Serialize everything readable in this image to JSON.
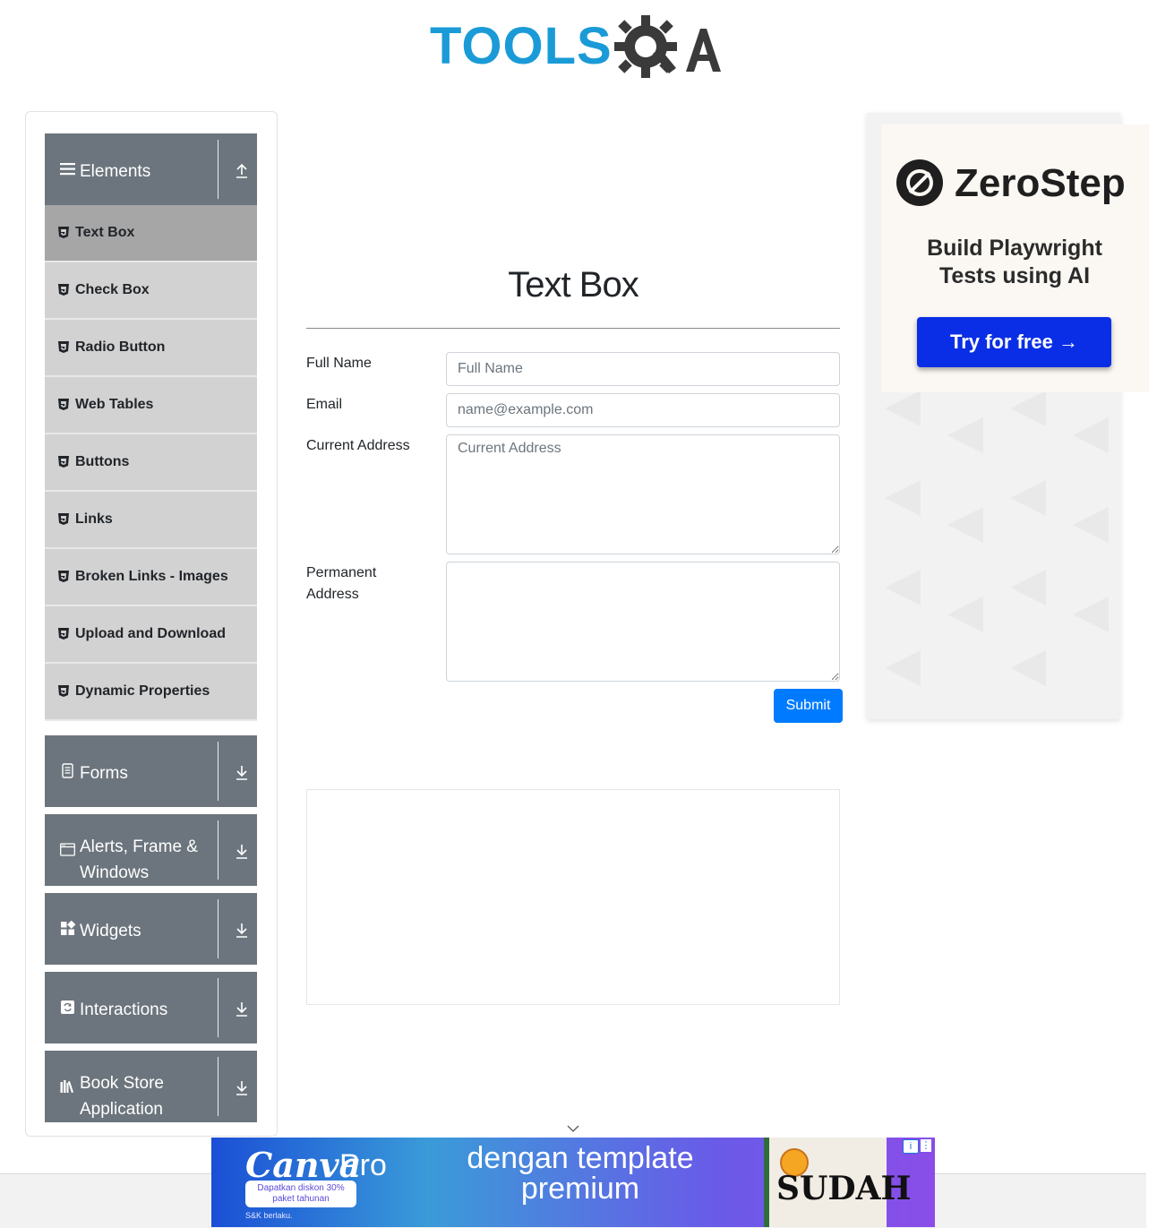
{
  "logo": {
    "text": "TOOLS",
    "suffix": "A"
  },
  "sidebar": {
    "groups": [
      {
        "title": "Elements",
        "icon": "menu-icon",
        "arrow": "collapse-arrow-icon",
        "items": [
          "Text Box",
          "Check Box",
          "Radio Button",
          "Web Tables",
          "Buttons",
          "Links",
          "Broken Links - Images",
          "Upload and Download",
          "Dynamic Properties"
        ],
        "active": "Text Box"
      },
      {
        "title": "Forms",
        "icon": "form-icon",
        "arrow": "expand-arrow-icon"
      },
      {
        "title": "Alerts, Frame & Windows",
        "icon": "window-icon",
        "arrow": "expand-arrow-icon"
      },
      {
        "title": "Widgets",
        "icon": "widgets-icon",
        "arrow": "expand-arrow-icon"
      },
      {
        "title": "Interactions",
        "icon": "interactions-icon",
        "arrow": "expand-arrow-icon"
      },
      {
        "title": "Book Store Application",
        "icon": "books-icon",
        "arrow": "expand-arrow-icon"
      }
    ]
  },
  "main": {
    "title": "Text Box",
    "form": {
      "full_name": {
        "label": "Full Name",
        "placeholder": "Full Name",
        "value": ""
      },
      "email": {
        "label": "Email",
        "placeholder": "name@example.com",
        "value": ""
      },
      "current_address": {
        "label": "Current Address",
        "placeholder": "Current Address",
        "value": ""
      },
      "permanent_address": {
        "label": "Permanent Address",
        "placeholder": "",
        "value": ""
      },
      "submit_label": "Submit"
    }
  },
  "ads": {
    "right": {
      "brand": "ZeroStep",
      "tagline": "Build Playwright Tests using AI",
      "cta": "Try for free →"
    },
    "bottom": {
      "brand": "Canva",
      "brand_suffix": "Pro",
      "discount": "Dapatkan diskon 30% paket tahunan",
      "terms": "S&K berlaku.",
      "headline": "dengan template premium",
      "book_title": "SUDAH"
    }
  }
}
